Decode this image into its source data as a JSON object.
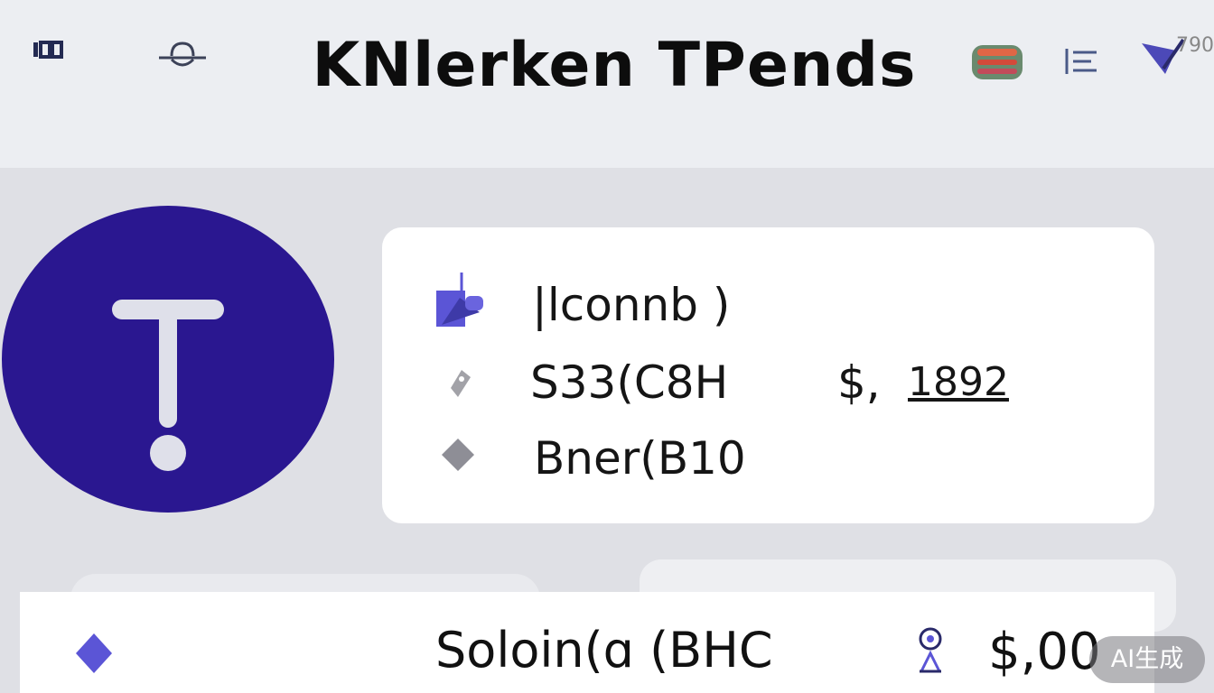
{
  "header": {
    "title": "KNlerken TPends",
    "left_icons": [
      "grid-icon",
      "profile-icon"
    ],
    "right_icons": [
      "wallet-icon",
      "list-icon",
      "check-icon"
    ],
    "corner_text": "790"
  },
  "logo": {
    "letter": "T",
    "color": "#2a1790"
  },
  "info_card": {
    "rows": [
      {
        "icon": "lock-icon",
        "label": "|lconnb )"
      },
      {
        "icon": "tag-icon",
        "label": "S33(C8H",
        "value": "$,",
        "value_extra": "1892"
      },
      {
        "icon": "diamond-icon",
        "label": "Bner(B10"
      }
    ]
  },
  "bottom_row": {
    "icon": "diamond-icon",
    "label": "Soloin(ɑ (BHC",
    "marker_icon": "pin-icon",
    "price": "$,00"
  },
  "watermark": "AI生成",
  "colors": {
    "accent": "#2a1790",
    "diamond": "#5b55d6",
    "background": "#dfe0e5",
    "header_background": "#eceef2"
  }
}
